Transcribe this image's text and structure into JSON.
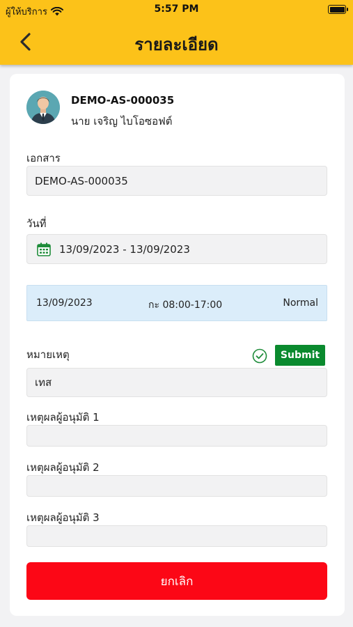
{
  "status_bar": {
    "carrier": "ผู้ให้บริการ",
    "time": "5:57 PM"
  },
  "header": {
    "title": "รายละเอียด"
  },
  "profile": {
    "doc_id": "DEMO-AS-000035",
    "name": "นาย เจริญ  ไบโอซอฟต์"
  },
  "document": {
    "label": "เอกสาร",
    "value": "DEMO-AS-000035"
  },
  "date": {
    "label": "วันที่",
    "value": "13/09/2023 - 13/09/2023"
  },
  "shift": {
    "date": "13/09/2023",
    "time": "กะ 08:00-17:00",
    "type": "Normal"
  },
  "remark": {
    "label": "หมายเหตุ",
    "value": "เทส",
    "submit_label": "Submit"
  },
  "approver_reasons": [
    {
      "label": "เหตุผลผู้อนุมัติ 1",
      "value": ""
    },
    {
      "label": "เหตุผลผู้อนุมัติ 2",
      "value": ""
    },
    {
      "label": "เหตุผลผู้อนุมัติ 3",
      "value": ""
    }
  ],
  "cancel_label": "ยกเลิก",
  "colors": {
    "header": "#fcc219",
    "submit": "#0a8a2e",
    "cancel": "#fc0716",
    "shift_bg": "#dbedfa"
  }
}
